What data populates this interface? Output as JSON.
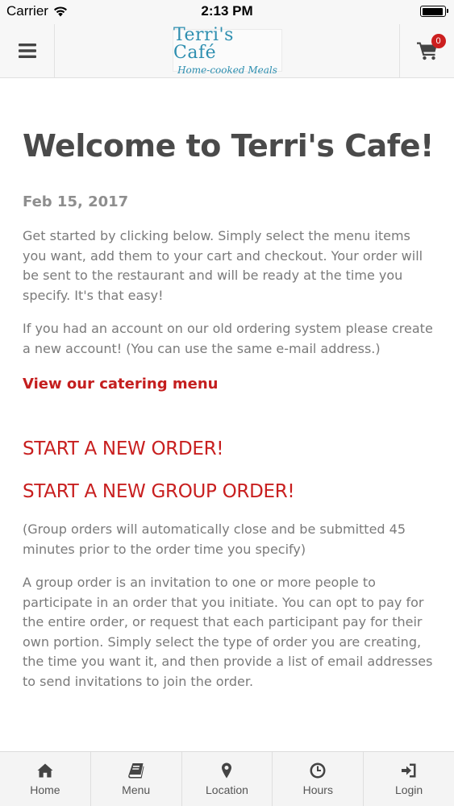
{
  "status_bar": {
    "carrier": "Carrier",
    "time": "2:13 PM",
    "battery_level": 0.95
  },
  "header": {
    "logo_title": "Terri's Café",
    "logo_subtitle": "Home-cooked Meals",
    "cart_count": "0",
    "menu_icon": "hamburger-icon",
    "cart_icon": "cart-icon"
  },
  "content": {
    "title": "Welcome to Terri's Cafe!",
    "date": "Feb 15, 2017",
    "intro": "Get started by clicking below. Simply select the menu items you want, add them to your cart and checkout. Your order will be sent to the restaurant and will be ready at the time you specify. It's that easy!",
    "account_note": "If you had an account on our old ordering system please create a new account! (You can use the same e-mail address.)",
    "catering_link": "View our catering menu",
    "start_order": "START A NEW ORDER!",
    "start_group_order": "START A NEW GROUP ORDER!",
    "group_note": "(Group orders will automatically close and be submitted 45 minutes prior to the order time you specify)",
    "group_description": "A group order is an invitation to one or more people to participate in an order that you initiate. You can opt to pay for the entire order, or request that each participant pay for their own portion. Simply select the type of order you are creating, the time you want it, and then provide a list of email addresses to send invitations to join the order."
  },
  "tabs": [
    {
      "label": "Home",
      "icon": "home-icon"
    },
    {
      "label": "Menu",
      "icon": "book-icon"
    },
    {
      "label": "Location",
      "icon": "map-marker-icon"
    },
    {
      "label": "Hours",
      "icon": "clock-icon"
    },
    {
      "label": "Login",
      "icon": "sign-in-icon"
    }
  ],
  "colors": {
    "accent_red": "#c81f1f",
    "logo_blue": "#2e8fb0",
    "text_gray": "#7a7a7a",
    "title_gray": "#4a4a4a"
  }
}
